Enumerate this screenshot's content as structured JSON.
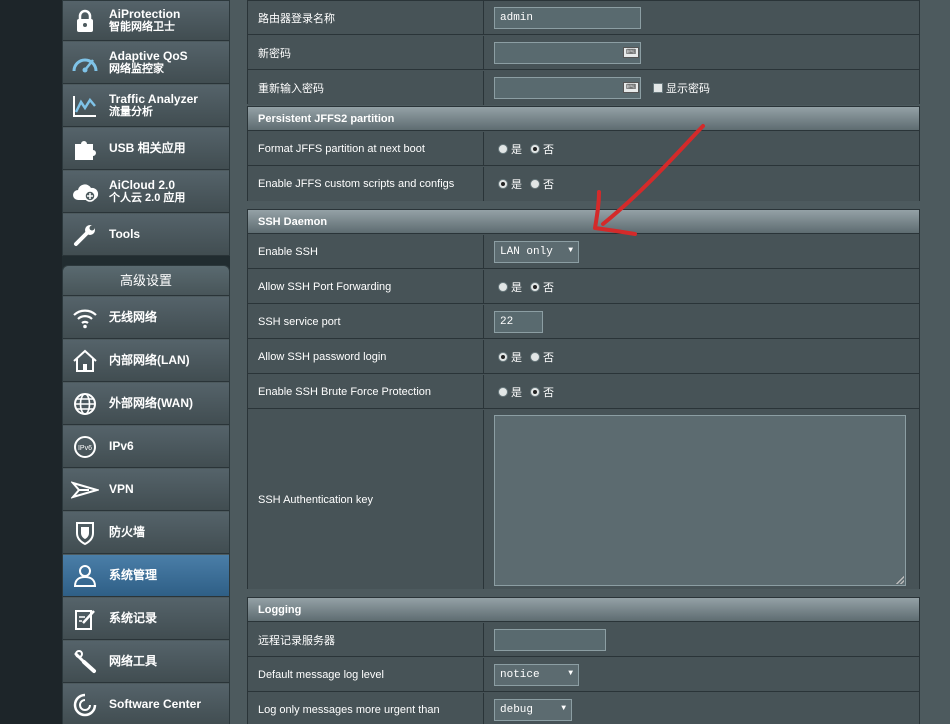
{
  "sidebar": {
    "top_items": [
      {
        "title": "AiProtection",
        "subtitle": "智能网络卫士",
        "icon": "lock-icon"
      },
      {
        "title": "Adaptive QoS",
        "subtitle": "网络监控家",
        "icon": "speedometer-icon"
      },
      {
        "title": "Traffic Analyzer",
        "subtitle": "流量分析",
        "icon": "chart-icon"
      },
      {
        "title": "USB 相关应用",
        "subtitle": "",
        "icon": "puzzle-icon"
      },
      {
        "title": "AiCloud 2.0",
        "subtitle": "个人云 2.0 应用",
        "icon": "cloud-icon"
      },
      {
        "title": "Tools",
        "subtitle": "",
        "icon": "wrench-icon"
      }
    ],
    "advanced_header": "高级设置",
    "advanced_items": [
      {
        "label": "无线网络",
        "icon": "wifi-icon"
      },
      {
        "label": "内部网络(LAN)",
        "icon": "home-icon"
      },
      {
        "label": "外部网络(WAN)",
        "icon": "globe-icon"
      },
      {
        "label": "IPv6",
        "icon": "ipv6-icon"
      },
      {
        "label": "VPN",
        "icon": "vpn-icon"
      },
      {
        "label": "防火墙",
        "icon": "shield-icon"
      },
      {
        "label": "系统管理",
        "icon": "admin-user-icon",
        "active": true
      },
      {
        "label": "系统记录",
        "icon": "log-edit-icon"
      },
      {
        "label": "网络工具",
        "icon": "network-tools-icon"
      },
      {
        "label": "Software Center",
        "icon": "software-center-icon"
      }
    ]
  },
  "account": {
    "username_label": "路由器登录名称",
    "username_value": "admin",
    "new_password_label": "新密码",
    "retype_password_label": "重新输入密码",
    "show_password_label": "显示密码",
    "keyboard_label": "⌨"
  },
  "jffs": {
    "header": "Persistent JFFS2 partition",
    "format_label": "Format JFFS partition at next boot",
    "scripts_label": "Enable JFFS custom scripts and configs"
  },
  "ssh": {
    "header": "SSH Daemon",
    "enable_label": "Enable SSH",
    "enable_value": "LAN only",
    "forwarding_label": "Allow SSH Port Forwarding",
    "port_label": "SSH service port",
    "port_value": "22",
    "password_login_label": "Allow SSH password login",
    "brute_force_label": "Enable SSH Brute Force Protection",
    "auth_key_label": "SSH Authentication key"
  },
  "logging": {
    "header": "Logging",
    "remote_server_label": "远程记录服务器",
    "default_level_label": "Default message log level",
    "default_level_value": "notice",
    "urgent_label": "Log only messages more urgent than",
    "urgent_value": "debug"
  },
  "radio": {
    "yes": "是",
    "no": "否"
  },
  "colors": {
    "annotation_arrow": "#d42a2a",
    "active_menu": "#3a6d96",
    "section_header": "#7d8b90"
  }
}
